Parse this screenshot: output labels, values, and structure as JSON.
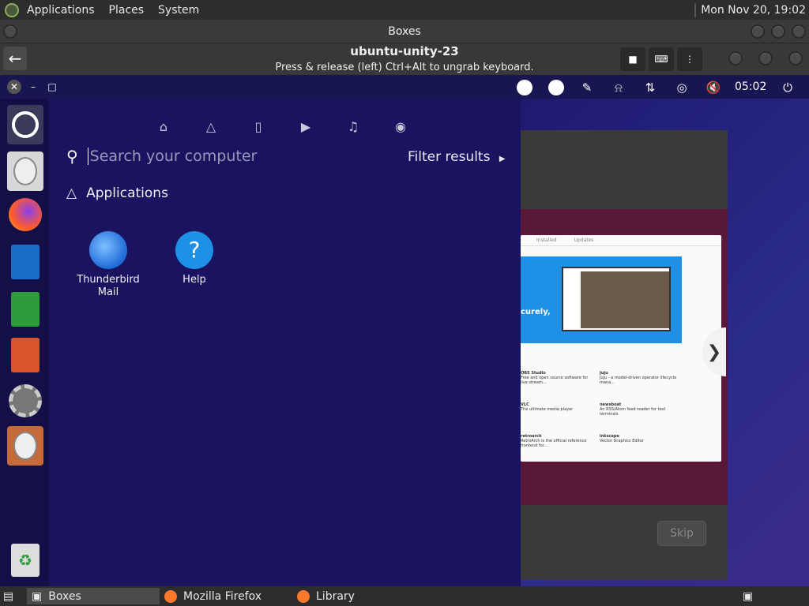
{
  "host_panel": {
    "menu": [
      "Applications",
      "Places",
      "System"
    ],
    "clock": "Mon Nov 20, 19:02"
  },
  "boxes": {
    "window_title": "Boxes",
    "vm_name": "ubuntu-unity-23",
    "hint": "Press & release (left) Ctrl+Alt to ungrab keyboard."
  },
  "vm_topbar": {
    "time": "05:02"
  },
  "dash": {
    "search_placeholder": "Search your computer",
    "filter_label": "Filter results",
    "section_heading": "Applications",
    "apps": [
      {
        "label": "Thunderbird Mail"
      },
      {
        "label": "Help"
      }
    ]
  },
  "installer": {
    "skip_label": "Skip",
    "store_tabs": [
      "Installed",
      "Updates"
    ],
    "featured_text": "curely,",
    "apps": [
      {
        "name": "OBS Studio",
        "desc": "Free and open source software for live stream..."
      },
      {
        "name": "Juju",
        "desc": "Juju - a model-driven operator lifecycle mana..."
      },
      {
        "name": "VLC",
        "desc": "The ultimate media player"
      },
      {
        "name": "newsboat",
        "desc": "An RSS/Atom feed reader for text terminals"
      },
      {
        "name": "retroarch",
        "desc": "RetroArch is the official reference frontend for..."
      },
      {
        "name": "inkscape",
        "desc": "Vector Graphics Editor"
      }
    ]
  },
  "taskbar": {
    "tasks": [
      "Boxes",
      "Mozilla Firefox",
      "Library"
    ]
  },
  "colors": {
    "vm_background": "#181650",
    "dash_background": "#1a1460",
    "launcher_background": "#140f46",
    "ubuntu_orange": "#e95420",
    "accent_blue": "#1e90e6"
  }
}
